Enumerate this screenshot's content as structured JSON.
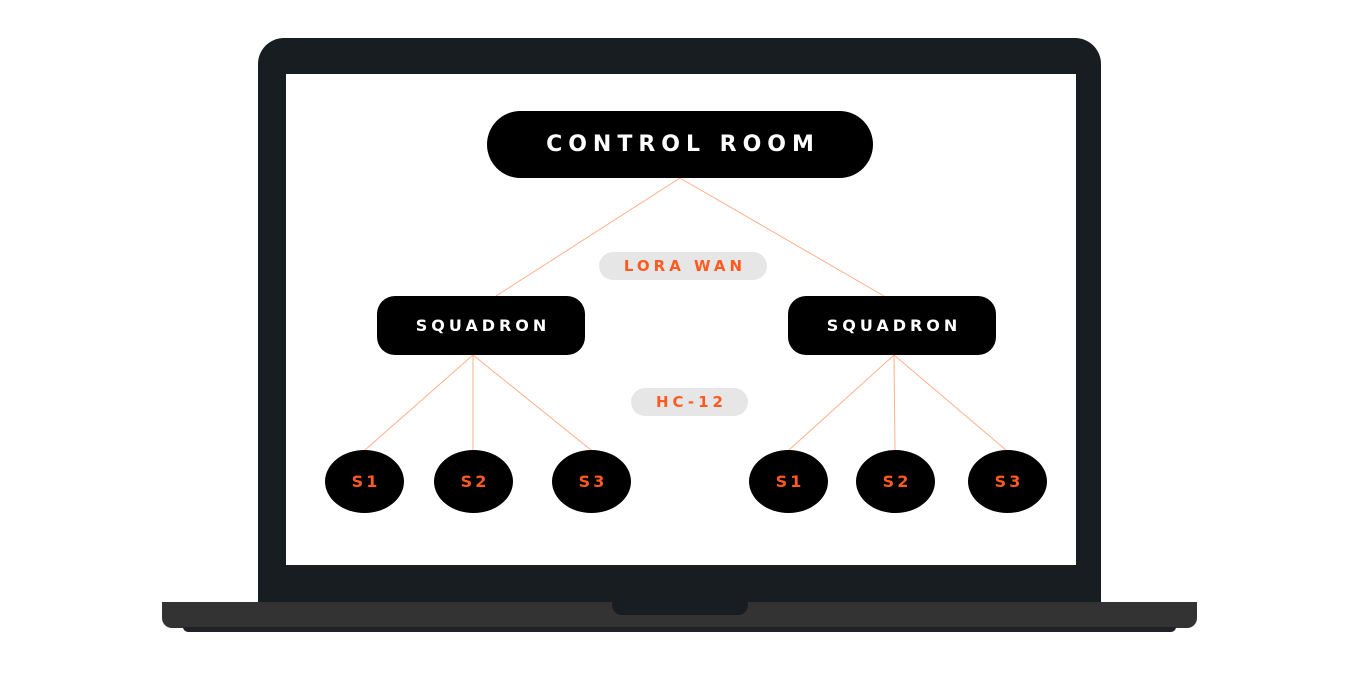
{
  "diagram": {
    "root": {
      "label": "CONTROL ROOM"
    },
    "links": {
      "top_link": "LORA WAN",
      "bottom_link": "HC-12"
    },
    "squadrons": [
      {
        "label": "SQUADRON",
        "sensors": [
          "S1",
          "S2",
          "S3"
        ]
      },
      {
        "label": "SQUADRON",
        "sensors": [
          "S1",
          "S2",
          "S3"
        ]
      }
    ]
  },
  "colors": {
    "accent": "#ff5a1f",
    "node_fill": "#000000",
    "tag_fill": "#e6e6e6",
    "laptop_frame": "#181d22",
    "laptop_base": "#333333",
    "connector": "#ffb08a"
  }
}
